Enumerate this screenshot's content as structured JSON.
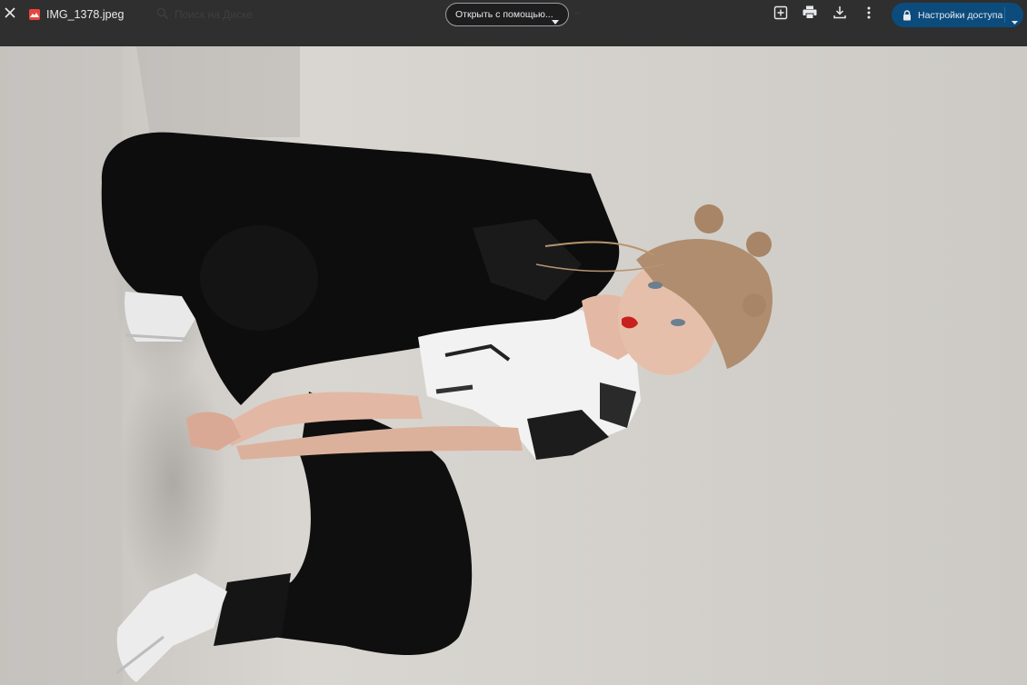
{
  "header": {
    "file_name": "IMG_1378.jpeg",
    "search_placeholder": "Поиск на Диске",
    "open_with_label": "Открыть с помощью...",
    "share_label": "Настройки доступа"
  },
  "icons": {
    "close": "close-icon",
    "file_type": "image-file-icon",
    "search": "search-icon",
    "add_shortcut": "add-to-drive-icon",
    "print": "print-icon",
    "download": "download-icon",
    "more": "more-vert-icon",
    "lock": "lock-icon",
    "dropdown": "arrow-drop-down-icon"
  },
  "colors": {
    "toolbar_bg": "#2f2f2f",
    "share_button_bg": "#0b4c7d",
    "file_icon": "#e8453c"
  }
}
